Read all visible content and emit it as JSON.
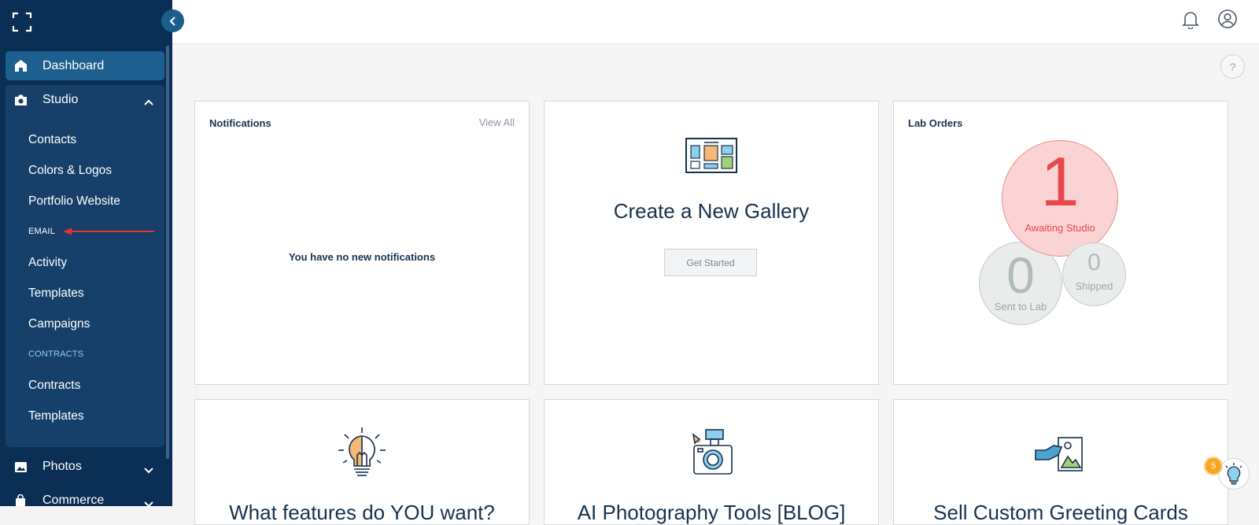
{
  "sidebar": {
    "dashboard_label": "Dashboard",
    "studio_label": "Studio",
    "studio_items": [
      "Contacts",
      "Colors & Logos",
      "Portfolio Website"
    ],
    "email_section": "EMAIL",
    "email_items": [
      "Activity",
      "Templates",
      "Campaigns"
    ],
    "contracts_section": "CONTRACTS",
    "contract_items": [
      "Contracts",
      "Templates"
    ],
    "photos_label": "Photos",
    "commerce_label": "Commerce"
  },
  "notifications": {
    "title": "Notifications",
    "view_all": "View All",
    "empty_message": "You have no new notifications"
  },
  "gallery": {
    "title": "Create a New Gallery",
    "button": "Get Started"
  },
  "lab_orders": {
    "title": "Lab Orders",
    "awaiting_count": "1",
    "awaiting_label": "Awaiting Studio",
    "sent_count": "0",
    "sent_label": "Sent to Lab",
    "shipped_count": "0",
    "shipped_label": "Shipped"
  },
  "bottom_cards": [
    {
      "title": "What features do YOU want?"
    },
    {
      "title": "AI Photography Tools [BLOG]"
    },
    {
      "title": "Sell Custom Greeting Cards"
    }
  ],
  "help": {
    "label": "?"
  },
  "tips": {
    "badge": "5"
  },
  "colors": {
    "sidebar": "#0b2e55",
    "active": "#1d5f8e",
    "accent_red": "#e8484b",
    "section_label": "#8ed0f2"
  },
  "icons": [
    "expand-icon",
    "chevron-left-icon",
    "home-icon",
    "camera-icon",
    "chevron-up-icon",
    "chevron-down-icon",
    "image-icon",
    "bag-icon",
    "bell-icon",
    "user-circle-icon",
    "help-icon",
    "gallery-icon",
    "lightbulb-icon",
    "camera-flash-icon",
    "card-icon",
    "arrow-annotation"
  ]
}
